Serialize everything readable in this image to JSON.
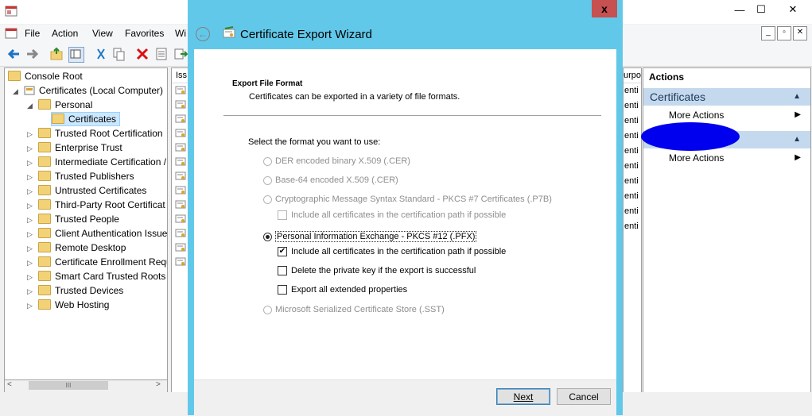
{
  "mmc": {
    "menu": [
      "File",
      "Action",
      "View",
      "Favorites",
      "Wi"
    ],
    "window_buttons": [
      "—",
      "☐",
      "✕"
    ],
    "child_buttons": [
      "_",
      "🗗",
      "✕"
    ],
    "tree": {
      "console_root": "Console Root",
      "root": "Certificates (Local Computer)",
      "personal": "Personal",
      "certificates": "Certificates",
      "items": [
        "Trusted Root Certification",
        "Enterprise Trust",
        "Intermediate Certification /",
        "Trusted Publishers",
        "Untrusted Certificates",
        "Third-Party Root Certificat",
        "Trusted People",
        "Client Authentication Issue",
        "Remote Desktop",
        "Certificate Enrollment Requ",
        "Smart Card Trusted Roots",
        "Trusted Devices",
        "Web Hosting"
      ]
    },
    "list_header_left": "Iss",
    "right_list_header": "urpo",
    "right_list_cells": [
      "enti",
      "enti",
      "enti",
      "enti",
      "enti",
      "enti",
      "enti",
      "enti",
      "enti",
      "enti"
    ],
    "actions": {
      "title": "Actions",
      "section1": "Certificates",
      "more_actions_1": "More Actions",
      "more_actions_2": "More Actions"
    },
    "scroll_thumb": "III"
  },
  "dialog": {
    "title": "Certificate Export Wizard",
    "close": "x",
    "heading": "Export File Format",
    "subheading": "Certificates can be exported in a variety of file formats.",
    "prompt": "Select the format you want to use:",
    "options": {
      "der": "DER encoded binary X.509 (.CER)",
      "base64": "Base-64 encoded X.509 (.CER)",
      "pkcs7": "Cryptographic Message Syntax Standard - PKCS #7 Certificates (.P7B)",
      "pkcs7_include": "Include all certificates in the certification path if possible",
      "pfx": "Personal Information Exchange - PKCS #12 (.PFX)",
      "pfx_include": "Include all certificates in the certification path if possible",
      "pfx_delete": "Delete the private key if the export is successful",
      "pfx_export_props": "Export all extended properties",
      "sst": "Microsoft Serialized Certificate Store (.SST)"
    },
    "pfx_selected": true,
    "pfx_include_checked": true,
    "buttons": {
      "next": "Next",
      "cancel": "Cancel"
    }
  },
  "colors": {
    "dialog_frame": "#62c8ea",
    "actions_header": "#c4d9ed",
    "redaction": "#0000ee"
  }
}
